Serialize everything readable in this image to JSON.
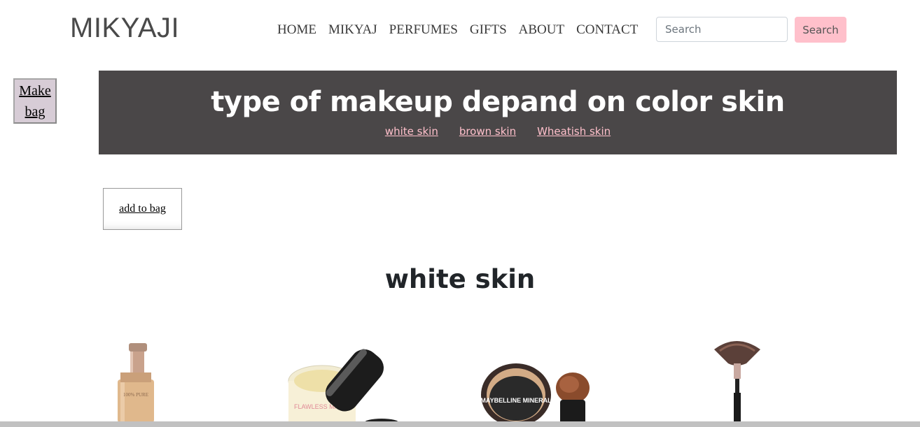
{
  "header": {
    "brand": "MIKYAJI",
    "nav": [
      "HOME",
      "MIKYAJ",
      "PERFUMES",
      "GIFTS",
      "ABOUT",
      "CONTACT"
    ],
    "search_placeholder": "Search",
    "search_button": "Search"
  },
  "bag_button": {
    "line1": "Make",
    "line2": "bag"
  },
  "banner": {
    "title": "type of makeup depand on color skin",
    "links": [
      "white skin",
      "brown skin",
      "Wheatish skin"
    ]
  },
  "add_to_bag": "add to bag",
  "section": {
    "title": "white skin"
  },
  "products": [
    {
      "name": "liquid-foundation",
      "label": "100% PURE"
    },
    {
      "name": "loose-powder",
      "label": "FLAWLESS MATTE"
    },
    {
      "name": "mineral-powder-brush",
      "label": "MAYBELLINE MINERAL"
    },
    {
      "name": "fan-brush",
      "label": ""
    }
  ]
}
